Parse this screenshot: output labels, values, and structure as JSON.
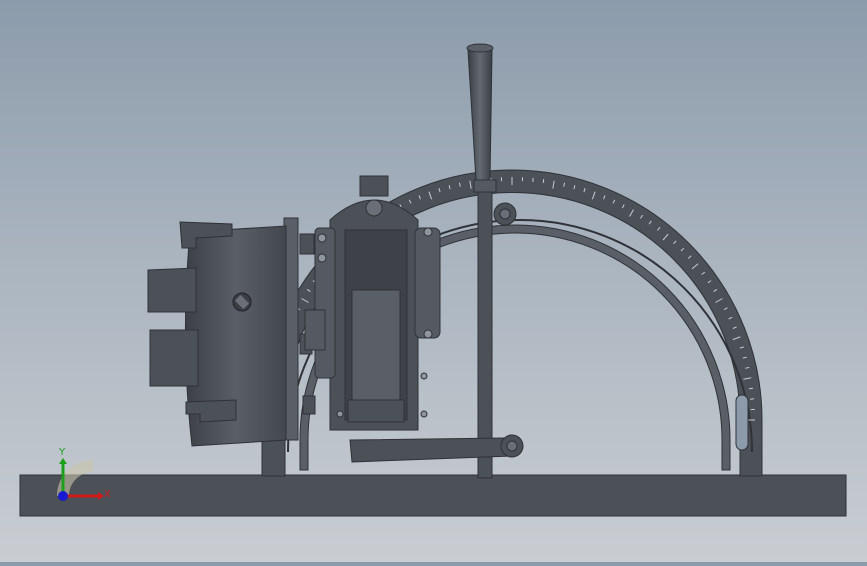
{
  "viewport": {
    "background_top": "#8c9bab",
    "background_bottom": "#c9cdd2",
    "part_color": "#4c5057",
    "part_dark": "#2f3238",
    "part_light": "#6a6f77"
  },
  "triad": {
    "x_label": "X",
    "y_label": "Y",
    "x_color": "#d11a1a",
    "y_color": "#1aa01a",
    "z_color": "#1a1ad1",
    "icon": "coordinate-triad-icon"
  }
}
